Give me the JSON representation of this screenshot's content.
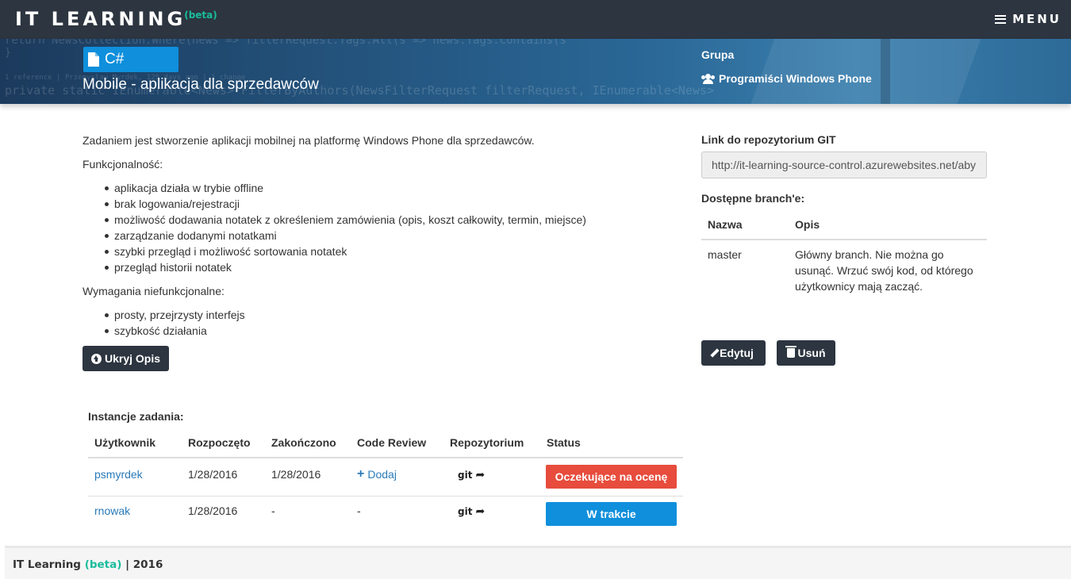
{
  "navbar": {
    "brand": "IT LEARNING",
    "beta": "(beta)",
    "menu_label": "MENU"
  },
  "banner": {
    "language": "C#",
    "task_title": "Mobile - aplikacja dla sprzedawców",
    "group_label": "Grupa",
    "group_name": "Programiści Windows Phone",
    "background_code": [
      "return NewsCollection.Where(news => filterRequest.Tags.All(s => news.Tags.Contains(s",
      "}",
      "1 reference | Przemysław Myrdek, 129 days ago | 1 change",
      "private static IEnumerable<News> FilterByAuthors(NewsFilterRequest filterRequest, IEnumerable<News>"
    ]
  },
  "description": {
    "intro": "Zadaniem jest stworzenie aplikacji mobilnej na platformę Windows Phone dla sprzedawców.",
    "functional_title": "Funkcjonalność:",
    "functional_items": [
      "aplikacja działa w trybie offline",
      "brak logowania/rejestracji",
      "możliwość dodawania notatek z określeniem zamówienia (opis, koszt całkowity, termin, miejsce)",
      "zarządzanie dodanymi notatkami",
      "szybki przegląd i możliwość sortowania notatek",
      "przegląd historii notatek"
    ],
    "nonfunctional_title": "Wymagania niefunkcjonalne:",
    "nonfunctional_items": [
      "prosty, przejrzysty interfejs",
      "szybkość działania"
    ],
    "toggle_label": "Ukryj Opis"
  },
  "instances": {
    "caption": "Instancje zadania:",
    "headers": [
      "Użytkownik",
      "Rozpoczęto",
      "Zakończono",
      "Code Review",
      "Repozytorium",
      "Status"
    ],
    "rows": [
      {
        "user": "psmyrdek",
        "started": "1/28/2016",
        "finished": "1/28/2016",
        "code_review": "Dodaj",
        "repo": "git",
        "status": "Oczekujące na ocenę",
        "status_color": "#e74c3c"
      },
      {
        "user": "rnowak",
        "started": "1/28/2016",
        "finished": "-",
        "code_review": "-",
        "repo": "git",
        "status": "W trakcie",
        "status_color": "#0f8fdc"
      }
    ]
  },
  "repository": {
    "label": "Link do repozytorium GIT",
    "url": "http://it-learning-source-control.azurewebsites.net/aby"
  },
  "branches": {
    "label": "Dostępne branch'e:",
    "headers": [
      "Nazwa",
      "Opis"
    ],
    "rows": [
      {
        "name": "master",
        "description_lines": [
          "Główny branch. Nie można go",
          "usunąć. Wrzuć swój kod, od którego",
          "użytkownicy mają zacząć."
        ]
      }
    ]
  },
  "actions": {
    "edit_label": "Edytuj",
    "delete_label": "Usuń"
  },
  "footer": {
    "brand": "IT Learning",
    "beta": "(beta)",
    "separator": "|",
    "year": "2016"
  },
  "colors": {
    "navbar": "#2c3540",
    "accent_blue": "#0f8fdc",
    "danger": "#e74c3c",
    "beta_green": "#1abc9c",
    "link": "#2a7ab8"
  }
}
